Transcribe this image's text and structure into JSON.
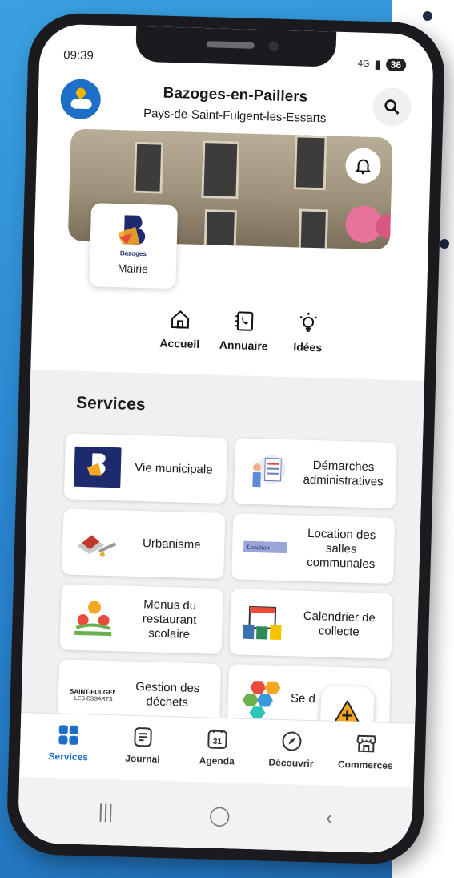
{
  "status_bar": {
    "time": "09:39",
    "network": "4G",
    "battery": "36"
  },
  "header": {
    "title": "Bazoges-en-Paillers",
    "subtitle": "Pays-de-Saint-Fulgent-les-Essarts"
  },
  "mairie_card": {
    "label": "Mairie",
    "logo_text": "Bazoges"
  },
  "quick_links": [
    {
      "label": "Accueil",
      "icon": "home-icon"
    },
    {
      "label": "Annuaire",
      "icon": "phone-book-icon"
    },
    {
      "label": "Idées",
      "icon": "lightbulb-icon"
    }
  ],
  "services": {
    "title": "Services",
    "items": [
      {
        "label": "Vie municipale"
      },
      {
        "label": "Démarches administratives"
      },
      {
        "label": "Urbanisme"
      },
      {
        "label": "Location des salles communales"
      },
      {
        "label": "Menus du restaurant scolaire"
      },
      {
        "label": "Calendrier de collecte"
      },
      {
        "label": "Gestion des déchets"
      },
      {
        "label": "Se d"
      }
    ]
  },
  "bottom_nav": [
    {
      "label": "Services",
      "active": true
    },
    {
      "label": "Journal"
    },
    {
      "label": "Agenda",
      "badge": "31"
    },
    {
      "label": "Découvrir"
    },
    {
      "label": "Commerces"
    }
  ],
  "colors": {
    "accent": "#1f6fc8",
    "fab_warning": "#f5a623"
  }
}
